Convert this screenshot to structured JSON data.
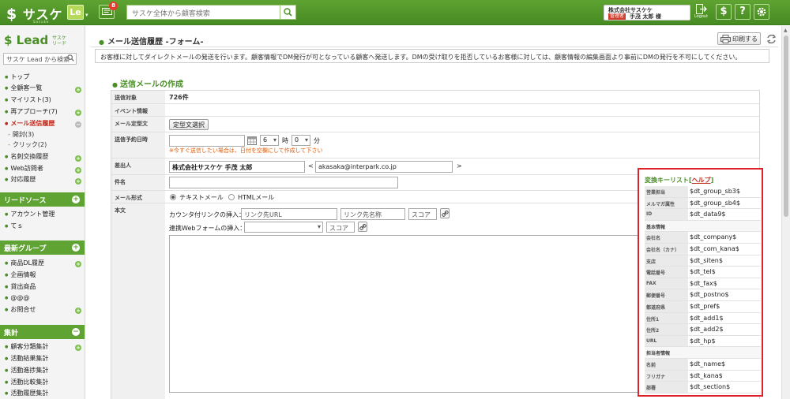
{
  "app": {
    "logo": "サスケ",
    "logo_sub": "Sasuke",
    "le_label": "Le",
    "notification_count": "8",
    "search_placeholder": "サスケ全体から顧客検索",
    "user_company": "株式会社サスケケ",
    "user_role": "管理者",
    "user_name": "手茂 太郎 様",
    "logout_label": "Logout",
    "help_label": "?"
  },
  "sidebar": {
    "brand": "Lead",
    "brand_sub_1": "サスケ",
    "brand_sub_2": "リード",
    "search_placeholder": "サスケ Lead から検索",
    "items": [
      {
        "label": "トップ"
      },
      {
        "label": "全顧客一覧"
      },
      {
        "label": "マイリスト(3)"
      },
      {
        "label": "再アプローチ(7)"
      },
      {
        "label": "メール送信履歴"
      },
      {
        "label": "開封(3)"
      },
      {
        "label": "クリック(2)"
      },
      {
        "label": "名刺交換履歴"
      },
      {
        "label": "Web訪問者"
      },
      {
        "label": "対応履歴"
      }
    ],
    "section_lead": "リードソース",
    "lead_items": [
      {
        "label": "アカウント管理"
      },
      {
        "label": "てｓ"
      }
    ],
    "section_group": "最新グループ",
    "group_items": [
      {
        "label": "商品DL履歴"
      },
      {
        "label": "企画情報"
      },
      {
        "label": "貸出商品"
      },
      {
        "label": "@@@"
      },
      {
        "label": "お問合せ"
      }
    ],
    "section_stats": "集計",
    "stats_items": [
      {
        "label": "顧客分類集計"
      },
      {
        "label": "活動結果集計"
      },
      {
        "label": "活動進捗集計"
      },
      {
        "label": "活動比較集計"
      },
      {
        "label": "活動履歴集計"
      }
    ]
  },
  "main": {
    "title": "メール送信履歴 -フォーム-",
    "print_label": "印刷する",
    "notice": "お客様に対してダイレクトメールの発送を行います。顧客情報でDM発行が可となっている顧客へ発送します。DMの受け取りを拒否しているお客様に対しては、顧客情報の編集画面より事前にDMの発行を不可にしてください。",
    "section_title": "送信メールの作成",
    "form": {
      "target_label": "送信対象",
      "target_value": "726件",
      "event_label": "イベント情報",
      "template_label": "メール定型文",
      "template_button": "定型文選択",
      "schedule_label": "送信予約日時",
      "hour_value": "6",
      "hour_unit": "時",
      "minute_value": "0",
      "minute_unit": "分",
      "schedule_warning": "※今すぐ送信したい場合は、日付を空欄にして作成して下さい",
      "sender_label": "差出人",
      "sender_name": "株式会社サスケケ 手茂 太郎",
      "lt": "<",
      "sender_email": "akasaka@interpark.co.jp",
      "gt": ">",
      "subject_label": "件名",
      "format_label": "メール形式",
      "format_text": "テキストメール",
      "format_html": "HTMLメール",
      "body_label": "本文",
      "count_link_label": "カウンタ付リンクの挿入：",
      "link_url_placeholder": "リンク先URL",
      "link_name_placeholder": "リンク先名称",
      "score_placeholder": "スコア",
      "webform_label": "連携Webフォームの挿入：",
      "webform_score_placeholder": "スコア"
    }
  },
  "keylist": {
    "title": "変換キーリスト",
    "help": "ヘルプ",
    "rows": [
      {
        "k": "営業担当",
        "v": "$dt_group_sb3$"
      },
      {
        "k": "メルマガ属性",
        "v": "$dt_group_sb4$"
      },
      {
        "k": "ID",
        "v": "$dt_data9$"
      },
      {
        "k": "基本情報",
        "v": ""
      },
      {
        "k": "会社名",
        "v": "$dt_company$"
      },
      {
        "k": "会社名（カナ）",
        "v": "$dt_com_kana$"
      },
      {
        "k": "支店",
        "v": "$dt_siten$"
      },
      {
        "k": "電話番号",
        "v": "$dt_tel$"
      },
      {
        "k": "FAX",
        "v": "$dt_fax$"
      },
      {
        "k": "郵便番号",
        "v": "$dt_postno$"
      },
      {
        "k": "都道府県",
        "v": "$dt_pref$"
      },
      {
        "k": "住所1",
        "v": "$dt_add1$"
      },
      {
        "k": "住所2",
        "v": "$dt_add2$"
      },
      {
        "k": "URL",
        "v": "$dt_hp$"
      },
      {
        "k": "担当者情報",
        "v": ""
      },
      {
        "k": "名前",
        "v": "$dt_name$"
      },
      {
        "k": "フリガナ",
        "v": "$dt_kana$"
      },
      {
        "k": "部署",
        "v": "$dt_section$"
      }
    ]
  }
}
